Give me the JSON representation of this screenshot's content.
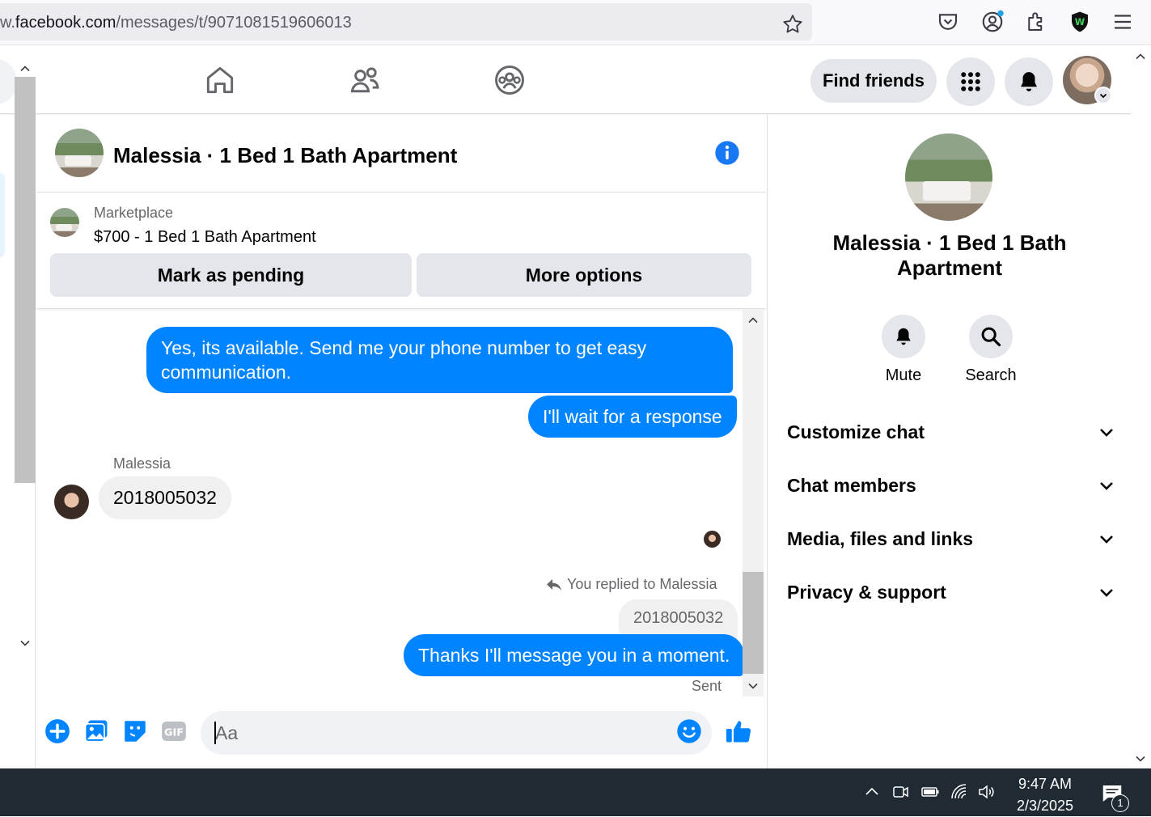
{
  "browser": {
    "url_prefix": "w.",
    "url_host": "facebook.com",
    "url_path": "/messages/t/9071081519606013"
  },
  "nav": {
    "find_friends_label": "Find friends"
  },
  "chat": {
    "title": "Malessia · 1 Bed 1 Bath Apartment",
    "marketplace_label": "Marketplace",
    "listing": "$700 - 1 Bed 1 Bath Apartment",
    "mark_pending_label": "Mark as pending",
    "more_options_label": "More options",
    "messages": {
      "out_1": "Yes, its available. Send me your phone number to get easy communication.",
      "out_2": "I'll wait for a response",
      "in_sender": "Malessia",
      "in_1": "2018005032",
      "reply_context": "You replied to Malessia",
      "quoted": "2018005032",
      "out_3": "Thanks I'll message you in a moment.",
      "status": "Sent"
    },
    "composer_placeholder": "Aa"
  },
  "info_panel": {
    "title": "Malessia · 1 Bed 1 Bath Apartment",
    "mute_label": "Mute",
    "search_label": "Search",
    "sections": [
      "Customize chat",
      "Chat members",
      "Media, files and links",
      "Privacy & support"
    ]
  },
  "taskbar": {
    "time": "9:47 AM",
    "date": "2/3/2025",
    "notification_count": "1"
  },
  "colors": {
    "messenger_blue": "#0084ff",
    "fb_blue": "#1877f2",
    "taskbar": "#1f2a33"
  }
}
